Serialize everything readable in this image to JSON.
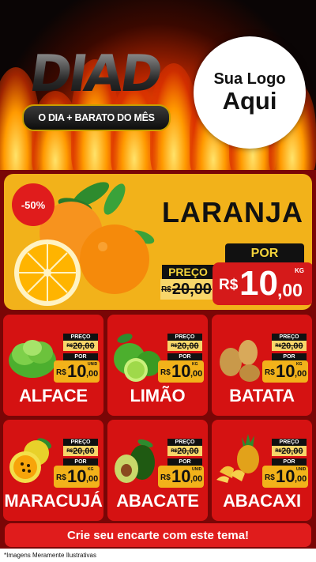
{
  "header": {
    "logo_text": "DIAD",
    "logo_subtitle": "O DIA + BARATO DO MÊS",
    "brand_line1": "Sua Logo",
    "brand_line2": "Aqui"
  },
  "hero": {
    "discount": "-50%",
    "title": "LARANJA",
    "preco_label": "PREÇO",
    "old_currency": "R$",
    "old_price": "20,00",
    "por_label": "POR",
    "currency": "R$",
    "price_int": "10",
    "price_dec": ",00",
    "unit": "KG"
  },
  "products": [
    {
      "name": "ALFACE",
      "preco_label": "PREÇO",
      "old_currency": "R$",
      "old_price": "20,00",
      "por_label": "POR",
      "currency": "R$",
      "price_int": "10",
      "price_dec": ",00",
      "unit": "UNID"
    },
    {
      "name": "LIMÃO",
      "preco_label": "PREÇO",
      "old_currency": "R$",
      "old_price": "20,00",
      "por_label": "POR",
      "currency": "R$",
      "price_int": "10",
      "price_dec": ",00",
      "unit": "KG"
    },
    {
      "name": "BATATA",
      "preco_label": "PREÇO",
      "old_currency": "R$",
      "old_price": "20,00",
      "por_label": "POR",
      "currency": "R$",
      "price_int": "10",
      "price_dec": ",00",
      "unit": "KG"
    },
    {
      "name": "MARACUJÁ",
      "preco_label": "PREÇO",
      "old_currency": "R$",
      "old_price": "20,00",
      "por_label": "POR",
      "currency": "R$",
      "price_int": "10",
      "price_dec": ",00",
      "unit": "KG"
    },
    {
      "name": "ABACATE",
      "preco_label": "PREÇO",
      "old_currency": "R$",
      "old_price": "20,00",
      "por_label": "POR",
      "currency": "R$",
      "price_int": "10",
      "price_dec": ",00",
      "unit": "UNID"
    },
    {
      "name": "ABACAXI",
      "preco_label": "PREÇO",
      "old_currency": "R$",
      "old_price": "20,00",
      "por_label": "POR",
      "currency": "R$",
      "price_int": "10",
      "price_dec": ",00",
      "unit": "UNID"
    }
  ],
  "cta": "Crie seu encarte com este tema!",
  "footer_note": "*Imagens Meramente Ilustrativas",
  "colors": {
    "red": "#d51212",
    "yellow": "#f2b21a",
    "dark_bg": "#7a0606"
  }
}
